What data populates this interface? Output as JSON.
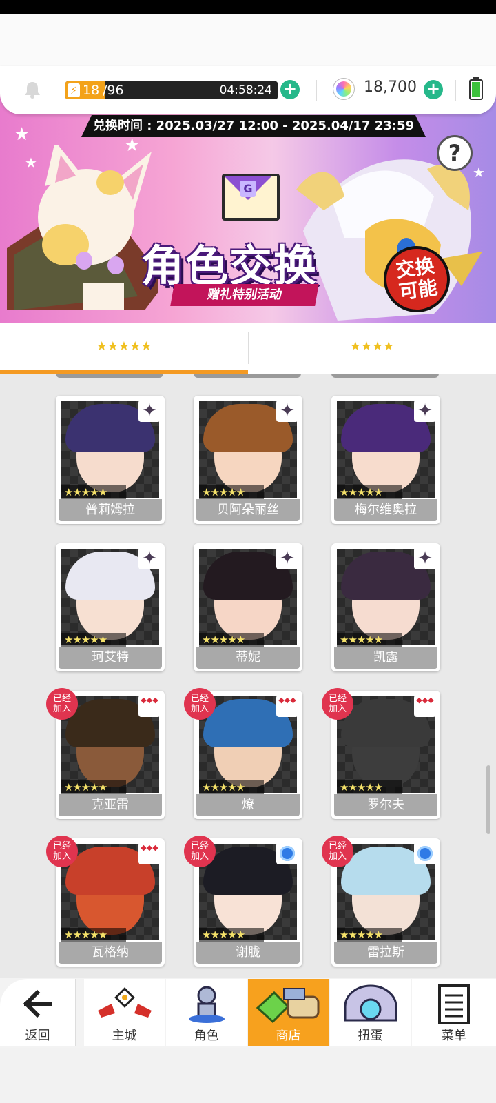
{
  "hud": {
    "stamina_current": "18",
    "stamina_max": "/96",
    "stamina_fraction": 0.1875,
    "stamina_timer": "04:58:24",
    "gems": "18,700"
  },
  "banner": {
    "exchange_period": "兑换时间 : 2025.03/27 12:00 - 2025.04/17 23:59",
    "help": "?",
    "title": "角色交换",
    "subtitle": "赠礼特别活动",
    "stamp": "交换\n可能",
    "envelope_letter": "G"
  },
  "tabs": [
    {
      "label": "★★★★★",
      "active": true
    },
    {
      "label": "★★★★",
      "active": false
    }
  ],
  "cards": [
    {
      "name": "普莉姆拉",
      "stars": "★★★★★",
      "badge": "shard",
      "joined": false
    },
    {
      "name": "贝阿朵丽丝",
      "stars": "★★★★★",
      "badge": "shard",
      "joined": false
    },
    {
      "name": "梅尔维奥拉",
      "stars": "★★★★★",
      "badge": "shard",
      "joined": false
    },
    {
      "name": "珂艾特",
      "stars": "★★★★★",
      "badge": "shard",
      "joined": false
    },
    {
      "name": "蒂妮",
      "stars": "★★★★★",
      "badge": "shard",
      "joined": false
    },
    {
      "name": "凯露",
      "stars": "★★★★★",
      "badge": "shard",
      "joined": false
    },
    {
      "name": "克亚雷",
      "stars": "★★★★★",
      "badge": "red",
      "joined": true
    },
    {
      "name": "燎",
      "stars": "★★★★★",
      "badge": "red",
      "joined": true
    },
    {
      "name": "罗尔夫",
      "stars": "★★★★★",
      "badge": "red",
      "joined": true
    },
    {
      "name": "瓦格纳",
      "stars": "★★★★★",
      "badge": "red",
      "joined": true
    },
    {
      "name": "谢胧",
      "stars": "★★★★★",
      "badge": "blue",
      "joined": true
    },
    {
      "name": "雷拉斯",
      "stars": "★★★★★",
      "badge": "blue",
      "joined": true
    }
  ],
  "joined_label": "已经\n加入",
  "nav": [
    {
      "label": "返回",
      "icon": "back-arrow-icon"
    },
    {
      "label": "主城",
      "icon": "castle-icon"
    },
    {
      "label": "角色",
      "icon": "character-icon"
    },
    {
      "label": "商店",
      "icon": "shop-icon",
      "active": true
    },
    {
      "label": "扭蛋",
      "icon": "gacha-icon"
    },
    {
      "label": "菜单",
      "icon": "menu-icon"
    }
  ],
  "colors": {
    "accent": "#f7a11e",
    "joined_badge": "#e0344f",
    "plus_button": "#26b88a"
  }
}
